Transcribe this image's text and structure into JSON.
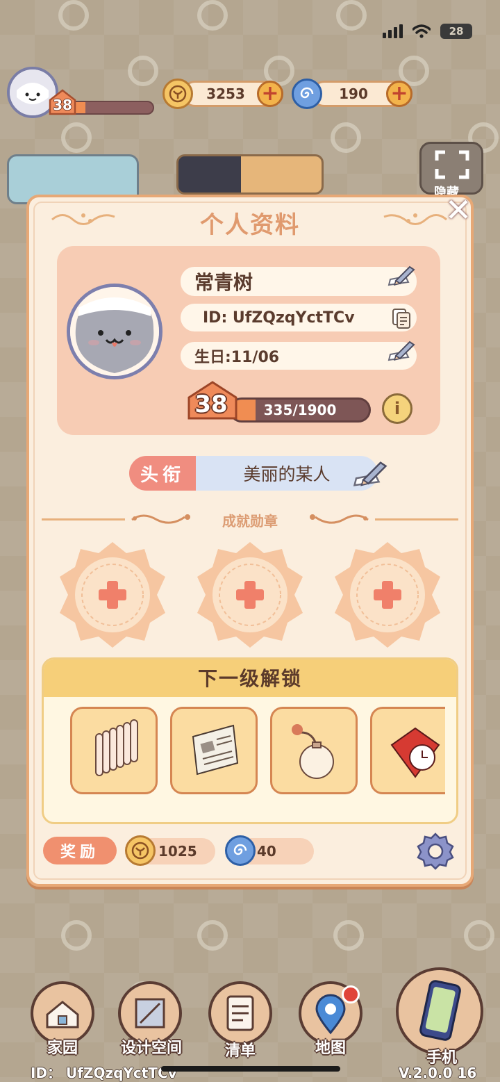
{
  "status_bar": {
    "battery": "28"
  },
  "hud": {
    "player_level": "38",
    "xp_fraction": 0.176,
    "coins": "3253",
    "gems": "190"
  },
  "side_labels": {
    "hide": "隐藏"
  },
  "profile": {
    "title": "个人资料",
    "name": "常青树",
    "id_text": "ID: UfZQzqYctTCv",
    "birthday": "生日:11/06",
    "level": "38",
    "xp_text": "335/1900",
    "xp_fraction": 0.176,
    "title_label": "头衔",
    "title_value": "美丽的某人",
    "achievements_label": "成就勋章",
    "unlock_header": "下一级解锁",
    "unlock_items": [
      "radiator",
      "newspaper",
      "bomb",
      "alarm-clock"
    ],
    "reward_label": "奖励",
    "reward_coins": "1025",
    "reward_gems": "40"
  },
  "nav": {
    "home": "家园",
    "design": "设计空间",
    "list": "清单",
    "map": "地图",
    "phone": "手机"
  },
  "footer": {
    "id_text": "ID： UfZQzqYctTCv",
    "version": "V.2.0.0 16"
  },
  "colors": {
    "accent": "#e09a6e",
    "panel": "#fbeede",
    "xp_fill": "#f08d52"
  }
}
